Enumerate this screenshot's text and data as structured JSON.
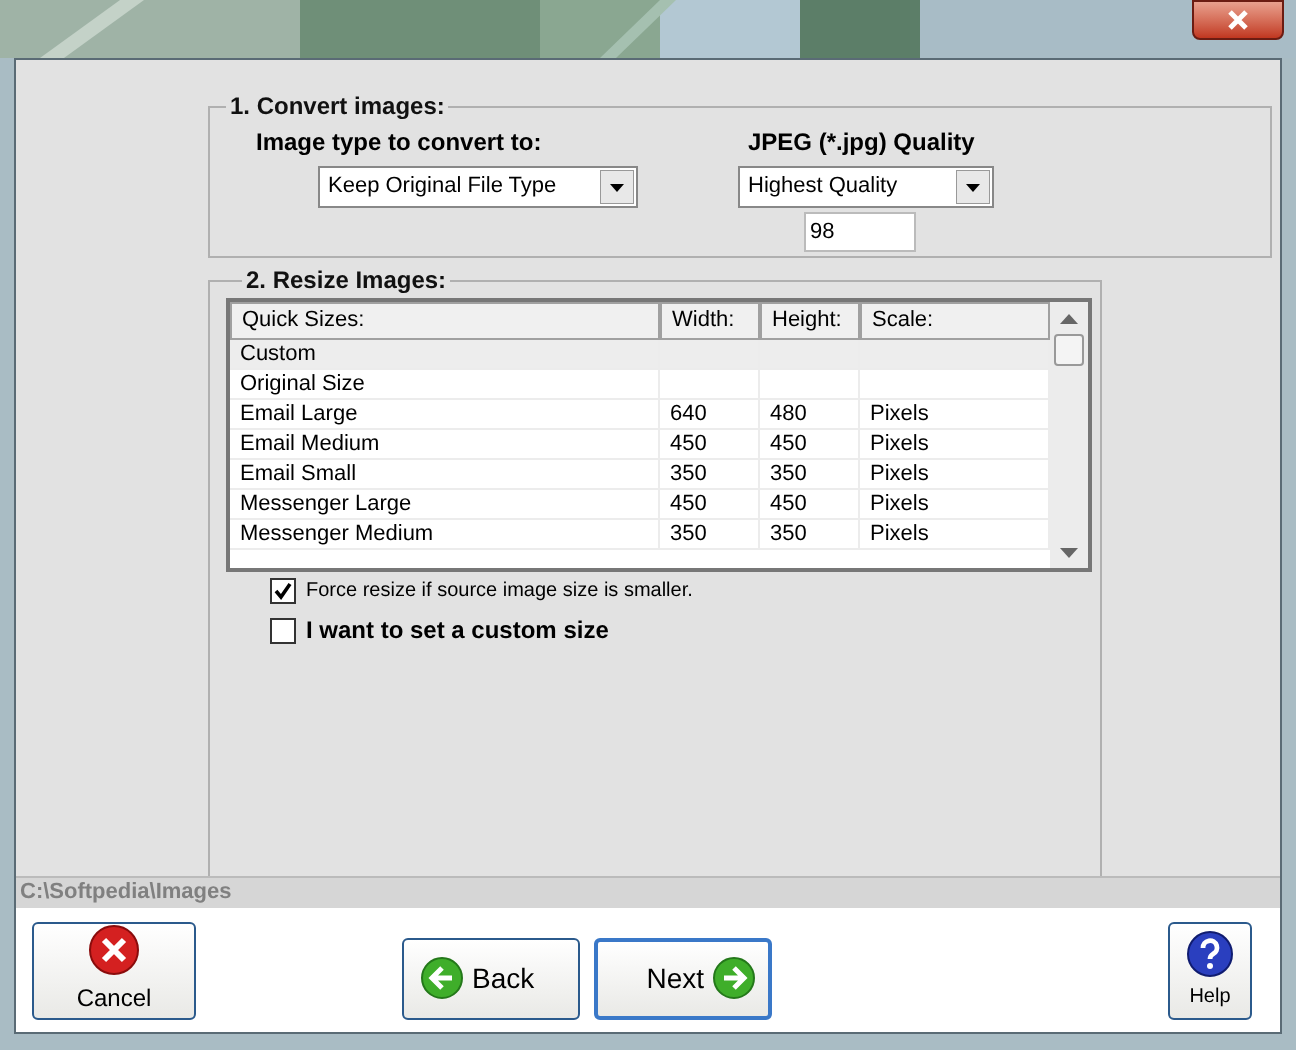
{
  "convert": {
    "title": "1. Convert images:",
    "type_label": "Image type to convert to:",
    "type_value": "Keep Original File Type",
    "quality_label": "JPEG (*.jpg) Quality",
    "quality_value": "Highest Quality",
    "quality_number": "98"
  },
  "resize": {
    "title": "2. Resize Images:",
    "columns": [
      "Quick Sizes:",
      "Width:",
      "Height:",
      "Scale:"
    ],
    "rows": [
      {
        "cells": [
          "Custom",
          "",
          "",
          ""
        ],
        "selected": true
      },
      {
        "cells": [
          "Original Size",
          "",
          "",
          ""
        ],
        "selected": false
      },
      {
        "cells": [
          "Email Large",
          "640",
          "480",
          "Pixels"
        ],
        "selected": false
      },
      {
        "cells": [
          "Email Medium",
          "450",
          "450",
          "Pixels"
        ],
        "selected": false
      },
      {
        "cells": [
          "Email Small",
          "350",
          "350",
          "Pixels"
        ],
        "selected": false
      },
      {
        "cells": [
          "Messenger Large",
          "450",
          "450",
          "Pixels"
        ],
        "selected": false
      },
      {
        "cells": [
          "Messenger Medium",
          "350",
          "350",
          "Pixels"
        ],
        "selected": false
      }
    ],
    "options": [
      {
        "label": "Force resize if source image size is smaller.",
        "checked": true,
        "kind": "small"
      },
      {
        "label": "I want to set a custom size",
        "checked": false,
        "kind": "bold"
      }
    ]
  },
  "path": "C:\\Softpedia\\Images",
  "buttons": [
    {
      "label": "Cancel",
      "kind": "cancel"
    },
    {
      "label": "Back",
      "kind": "back"
    },
    {
      "label": "Next",
      "kind": "next"
    },
    {
      "label": "Help",
      "kind": "help"
    }
  ]
}
